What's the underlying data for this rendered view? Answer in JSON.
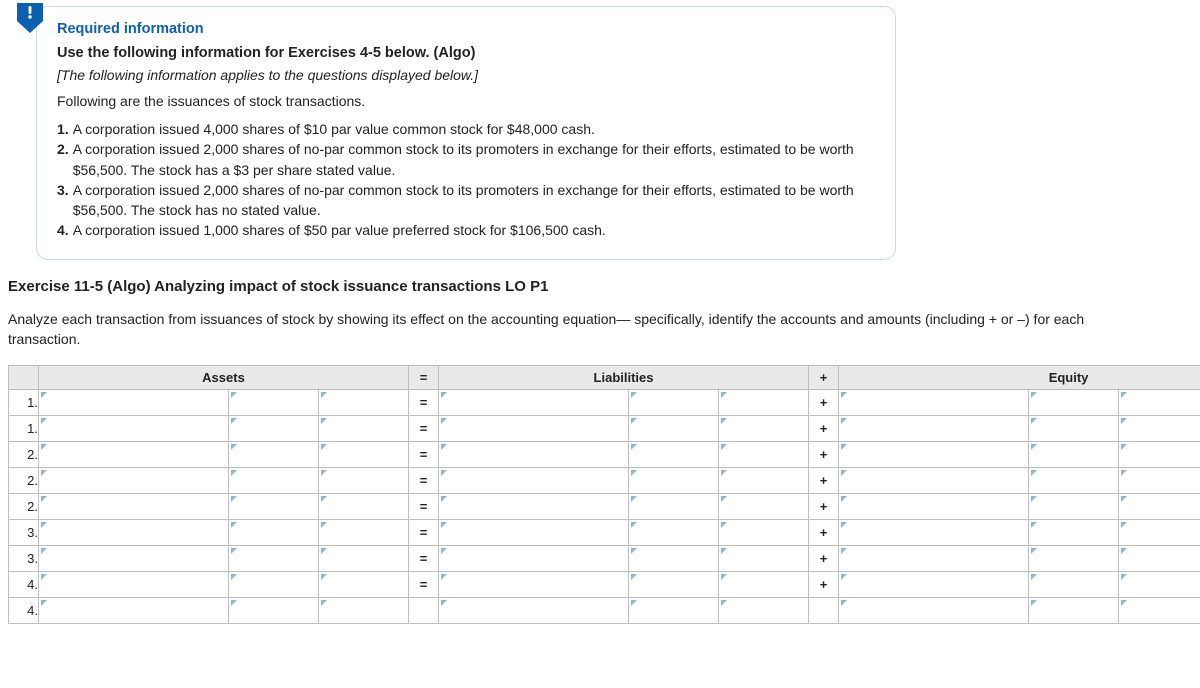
{
  "req": {
    "title": "Required information",
    "use_line": "Use the following information for Exercises 4-5 below. (Algo)",
    "note": "[The following information applies to the questions displayed below.]",
    "intro": "Following are the issuances of stock transactions.",
    "items": [
      {
        "n": "1.",
        "t": "A corporation issued 4,000 shares of $10 par value common stock for $48,000 cash."
      },
      {
        "n": "2.",
        "t": "A corporation issued 2,000 shares of no-par common stock to its promoters in exchange for their efforts, estimated to be worth $56,500. The stock has a $3 per share stated value."
      },
      {
        "n": "3.",
        "t": "A corporation issued 2,000 shares of no-par common stock to its promoters in exchange for their efforts, estimated to be worth $56,500. The stock has no stated value."
      },
      {
        "n": "4.",
        "t": "A corporation issued 1,000 shares of $50 par value preferred stock for $106,500 cash."
      }
    ]
  },
  "exercise": {
    "title": "Exercise 11-5 (Algo) Analyzing impact of stock issuance transactions LO P1",
    "desc": "Analyze each transaction from issuances of stock by showing its effect on the accounting equation— specifically, identify the accounts and amounts (including + or –) for each transaction."
  },
  "table": {
    "headers": {
      "assets": "Assets",
      "eq": "=",
      "liab": "Liabilities",
      "plus": "+",
      "equity": "Equity"
    },
    "rows": [
      {
        "n": "1.",
        "eq": "=",
        "plus": "+"
      },
      {
        "n": "1.",
        "eq": "=",
        "plus": "+"
      },
      {
        "n": "2.",
        "eq": "=",
        "plus": "+"
      },
      {
        "n": "2.",
        "eq": "=",
        "plus": "+"
      },
      {
        "n": "2.",
        "eq": "=",
        "plus": "+"
      },
      {
        "n": "3.",
        "eq": "=",
        "plus": "+"
      },
      {
        "n": "3.",
        "eq": "=",
        "plus": "+"
      },
      {
        "n": "4.",
        "eq": "=",
        "plus": "+"
      },
      {
        "n": "4.",
        "eq": "",
        "plus": ""
      }
    ]
  }
}
